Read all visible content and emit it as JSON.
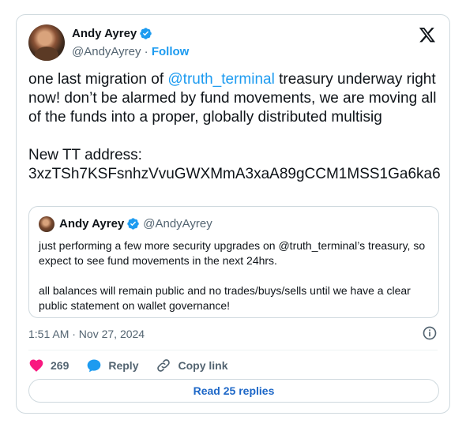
{
  "author": {
    "name": "Andy Ayrey",
    "handle": "@AndyAyrey",
    "separator": "·",
    "follow_label": "Follow"
  },
  "tweet": {
    "text_part1": "one last migration of ",
    "mention": "@truth_terminal",
    "text_part2": " treasury underway right now! don’t be alarmed by fund movements, we are moving all of the funds into a proper, globally distributed multisig\n\nNew TT address:\n3xzTSh7KSFsnhzVvuGWXMmA3xaA89gCCM1MSS1Ga6ka6"
  },
  "quoted_tweet": {
    "name": "Andy Ayrey",
    "handle": "@AndyAyrey",
    "text": "just performing a few more security upgrades on @truth_terminal’s treasury, so expect to see fund movements in the next 24hrs.\n\nall balances will remain public and no trades/buys/sells until we have a clear public statement on wallet governance!"
  },
  "timestamp": "1:51 AM · Nov 27, 2024",
  "actions": {
    "likes_count": "269",
    "reply_label": "Reply",
    "copy_link_label": "Copy link"
  },
  "read_replies_label": "Read 25 replies",
  "colors": {
    "accent": "#1d9bf0",
    "like": "#f91880",
    "text": "#0f1419",
    "muted": "#536471",
    "border": "#cfd9de"
  },
  "icons": [
    "verified-badge-icon",
    "x-logo-icon",
    "info-icon",
    "heart-icon",
    "reply-bubble-icon",
    "link-icon"
  ]
}
